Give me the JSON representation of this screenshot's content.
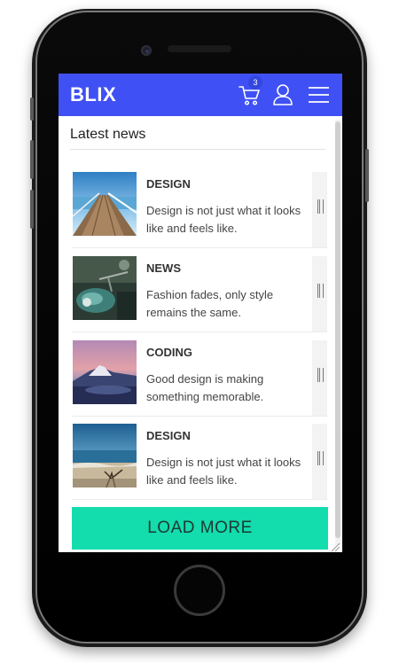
{
  "app": {
    "brand": "BLIX",
    "cart_count": "3",
    "accent_color": "#3f51f5",
    "button_color": "#13dcad"
  },
  "header_icons": [
    "cart-icon",
    "user-icon",
    "hamburger-menu-icon"
  ],
  "section": {
    "title": "Latest news"
  },
  "news": [
    {
      "category": "DESIGN",
      "description": "Design is not just what it looks like and feels like.",
      "image": "pier-photo"
    },
    {
      "category": "NEWS",
      "description": "Fashion fades, only style remains the same.",
      "image": "scooter-photo"
    },
    {
      "category": "CODING",
      "description": "Good design is making something memorable.",
      "image": "mountain-sunset-photo"
    },
    {
      "category": "DESIGN",
      "description": "Design is not just what it looks like and feels like.",
      "image": "beach-photo"
    }
  ],
  "load_more_label": "LOAD MORE"
}
